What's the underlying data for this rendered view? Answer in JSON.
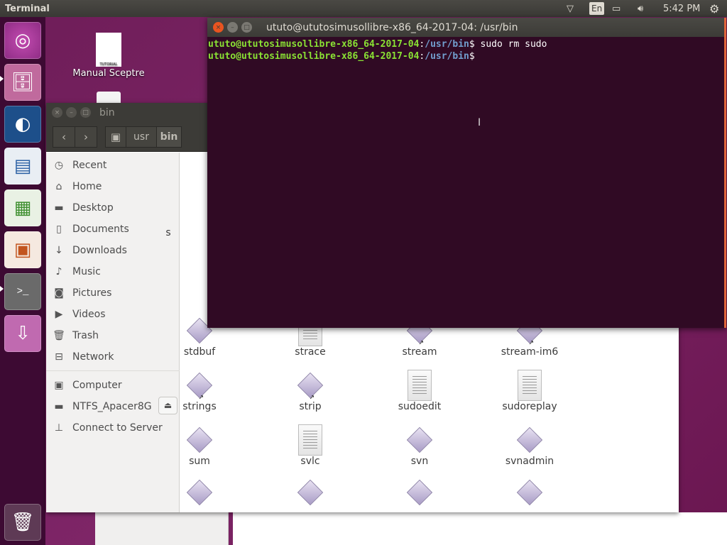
{
  "panel": {
    "app_title": "Terminal",
    "lang": "En",
    "clock": "5:42 PM"
  },
  "launcher": {
    "items": [
      "ubuntu-dash-icon",
      "files-icon",
      "browser-icon",
      "writer-icon",
      "calc-icon",
      "impress-icon",
      "terminal-icon",
      "usb-drive-icon",
      "trash-icon"
    ]
  },
  "desktop": {
    "icons": [
      {
        "label": "Manual Sceptre",
        "badge": "TUTORIAL"
      }
    ]
  },
  "terminal": {
    "title": "ututo@ututosimusollibre-x86_64-2017-04: /usr/bin",
    "lines": [
      {
        "user": "ututo@ututosimusollibre-x86_64-2017-04",
        "path": "/usr/bin",
        "cmd": "sudo rm sudo"
      },
      {
        "user": "ututo@ututosimusollibre-x86_64-2017-04",
        "path": "/usr/bin",
        "cmd": ""
      }
    ]
  },
  "files": {
    "title": "bin",
    "breadcrumb": [
      "usr",
      "bin"
    ],
    "sidebar": [
      {
        "label": "Recent",
        "icon": "clock"
      },
      {
        "label": "Home",
        "icon": "home"
      },
      {
        "label": "Desktop",
        "icon": "folder"
      },
      {
        "label": "Documents",
        "icon": "document"
      },
      {
        "label": "Downloads",
        "icon": "download"
      },
      {
        "label": "Music",
        "icon": "music"
      },
      {
        "label": "Pictures",
        "icon": "camera"
      },
      {
        "label": "Videos",
        "icon": "video"
      },
      {
        "label": "Trash",
        "icon": "trash"
      },
      {
        "label": "Network",
        "icon": "network"
      }
    ],
    "devices": [
      {
        "label": "Computer"
      },
      {
        "label": "NTFS_Apacer8G"
      },
      {
        "label": "Connect to Server"
      }
    ],
    "partial_label": "s",
    "items": [
      {
        "name": "stdbuf",
        "type": "exec",
        "link": false
      },
      {
        "name": "strace",
        "type": "text",
        "link": false
      },
      {
        "name": "stream",
        "type": "exec",
        "link": true
      },
      {
        "name": "stream-im6",
        "type": "exec",
        "link": true
      },
      {
        "name": "strings",
        "type": "exec",
        "link": true
      },
      {
        "name": "strip",
        "type": "exec",
        "link": true
      },
      {
        "name": "sudoedit",
        "type": "text",
        "link": false
      },
      {
        "name": "sudoreplay",
        "type": "text",
        "link": false
      },
      {
        "name": "sum",
        "type": "exec",
        "link": false
      },
      {
        "name": "svlc",
        "type": "text",
        "link": false
      },
      {
        "name": "svn",
        "type": "exec",
        "link": false
      },
      {
        "name": "svnadmin",
        "type": "exec",
        "link": false
      }
    ]
  }
}
